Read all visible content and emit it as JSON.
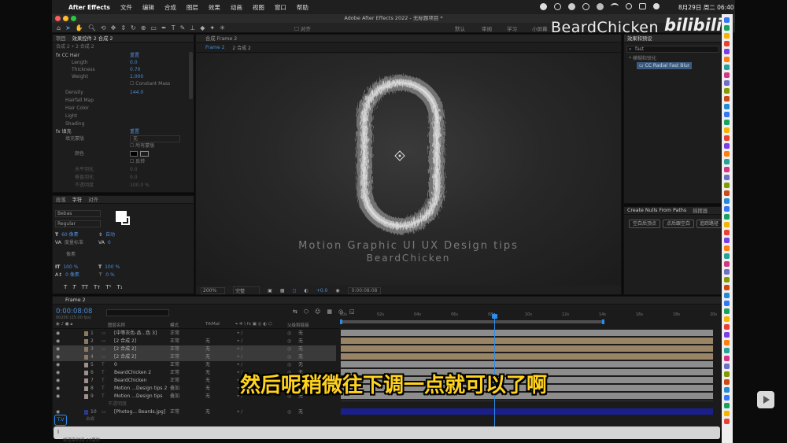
{
  "menubar": {
    "apple_icon": "apple-icon",
    "app": "After Effects",
    "items": [
      "文件",
      "编辑",
      "合成",
      "图层",
      "效果",
      "动画",
      "视图",
      "窗口",
      "帮助"
    ],
    "datetime": "8月29日 周二 06:40"
  },
  "window": {
    "title": "Adobe After Effects 2022 - 无标题项目 *"
  },
  "toolbar": {
    "align": "对齐",
    "workspaces": [
      "默认",
      "审阅",
      "学习",
      "小屏幕"
    ]
  },
  "watermark": {
    "channel": "BeardChicken",
    "site": "bilibili"
  },
  "effects_panel": {
    "tabs": [
      "项目",
      "效果控件 2 合成 2"
    ],
    "breadcrumb": "合成 2 • 2 合成 2",
    "rows": [
      {
        "label": "fx  CC Hair",
        "value": "重置"
      },
      {
        "label": "Length",
        "value": "0.0"
      },
      {
        "label": "Thickness",
        "value": "0.70"
      },
      {
        "label": "Weight",
        "value": "1.000"
      },
      {
        "label": "",
        "value": "Constant Mass"
      },
      {
        "label": "Density",
        "value": "144.0"
      },
      {
        "label": "Hairfall Map",
        "value": ""
      },
      {
        "label": "Hair Color",
        "value": ""
      },
      {
        "label": "Light",
        "value": ""
      },
      {
        "label": "Shading",
        "value": ""
      },
      {
        "label": "fx  填充",
        "value": "重置"
      },
      {
        "label": "填充蒙版",
        "value": "无"
      },
      {
        "label": "",
        "value": "所有蒙版"
      },
      {
        "label": "颜色",
        "value": ""
      },
      {
        "label": "",
        "value": "反转"
      },
      {
        "label": "水平羽化",
        "value": "0.0"
      },
      {
        "label": "垂直羽化",
        "value": "0.0"
      },
      {
        "label": "不透明度",
        "value": "100.0 %"
      }
    ]
  },
  "character_panel": {
    "tabs": [
      "段落",
      "字符",
      "对齐"
    ],
    "font": "Bebas",
    "style": "Regular",
    "size": "60 像素",
    "auto": "自动",
    "metrics": "度量标准",
    "tracking": "0",
    "stroke": "像素",
    "vscale": "100 %",
    "hscale": "100 %",
    "baseline": "0 像素",
    "tsume": "0 %",
    "style_buttons": [
      "T",
      "T",
      "TT",
      "Tт",
      "T¹",
      "T₁"
    ]
  },
  "composition": {
    "tab": "合成 Frame 2",
    "flows": [
      "Frame 2",
      "2 合成 2"
    ],
    "text_line1": "Motion Graphic UI UX Design tips",
    "text_line2": "BeardChicken",
    "zoom": "200%",
    "quality": "完整",
    "exposure": "+0.0",
    "timecode": "0:00:08:08"
  },
  "effects_presets": {
    "title": "效果和预设",
    "search": "fast",
    "category": "* 模糊和锐化",
    "result": "CC Radial Fast Blur"
  },
  "nulls_panel": {
    "tabs": [
      "Create Nulls From Paths",
      "摇摆器"
    ],
    "buttons": [
      "空白后顶点",
      "点后跟空白",
      "追踪路径"
    ]
  },
  "timeline": {
    "tab": "Frame 2",
    "timecode": "0:00:08:08",
    "fps": "00200 (25.00 fps)",
    "columns": {
      "name": "图层名称",
      "mode": "模式",
      "trkmat": "TrkMat",
      "parent": "父级和链接"
    },
    "ruler": [
      "00s",
      "02s",
      "04s",
      "06s",
      "08s",
      "10s",
      "12s",
      "14s",
      "16s",
      "18s",
      "20s"
    ],
    "layers": [
      {
        "num": "1",
        "name": "[中等灰色-品...色 3]",
        "mode": "正常",
        "trk": "",
        "parent": "无"
      },
      {
        "num": "2",
        "name": "[2 合成 2]",
        "mode": "正常",
        "trk": "无",
        "parent": "无"
      },
      {
        "num": "3",
        "name": "[2 合成 2]",
        "mode": "正常",
        "trk": "无",
        "parent": "无"
      },
      {
        "num": "4",
        "name": "[2 合成 2]",
        "mode": "正常",
        "trk": "无",
        "parent": "无"
      },
      {
        "num": "5",
        "name": "0",
        "mode": "正常",
        "trk": "无",
        "parent": "无"
      },
      {
        "num": "6",
        "name": "BeardChicken 2",
        "mode": "正常",
        "trk": "无",
        "parent": "无"
      },
      {
        "num": "7",
        "name": "BeardChicken",
        "mode": "正常",
        "trk": "无",
        "parent": "无"
      },
      {
        "num": "8",
        "name": "Motion ...Design tips 2",
        "mode": "叠加",
        "trk": "无",
        "parent": "无"
      },
      {
        "num": "9",
        "name": "Motion ...Design tips",
        "mode": "叠加",
        "trk": "无",
        "parent": "无"
      },
      {
        "num": "",
        "name": "不透明度",
        "mode": "",
        "trk": "",
        "parent": ""
      },
      {
        "num": "10",
        "name": "[Photog... Beards.jpg]",
        "mode": "正常",
        "trk": "无",
        "parent": "无"
      }
    ],
    "sub_label": "合成",
    "input_hint": "T.V",
    "bottom": "帧渲染时间  23毫秒"
  },
  "subtitle": "然后呢稍微往下调一点就可以了啊",
  "colors": {
    "accent": "#2d8ceb",
    "subtitle": "#ffd21e",
    "tan": "#9a8466",
    "layerbar": "#8d8d8d",
    "bluebar": "#1a1f8a"
  }
}
